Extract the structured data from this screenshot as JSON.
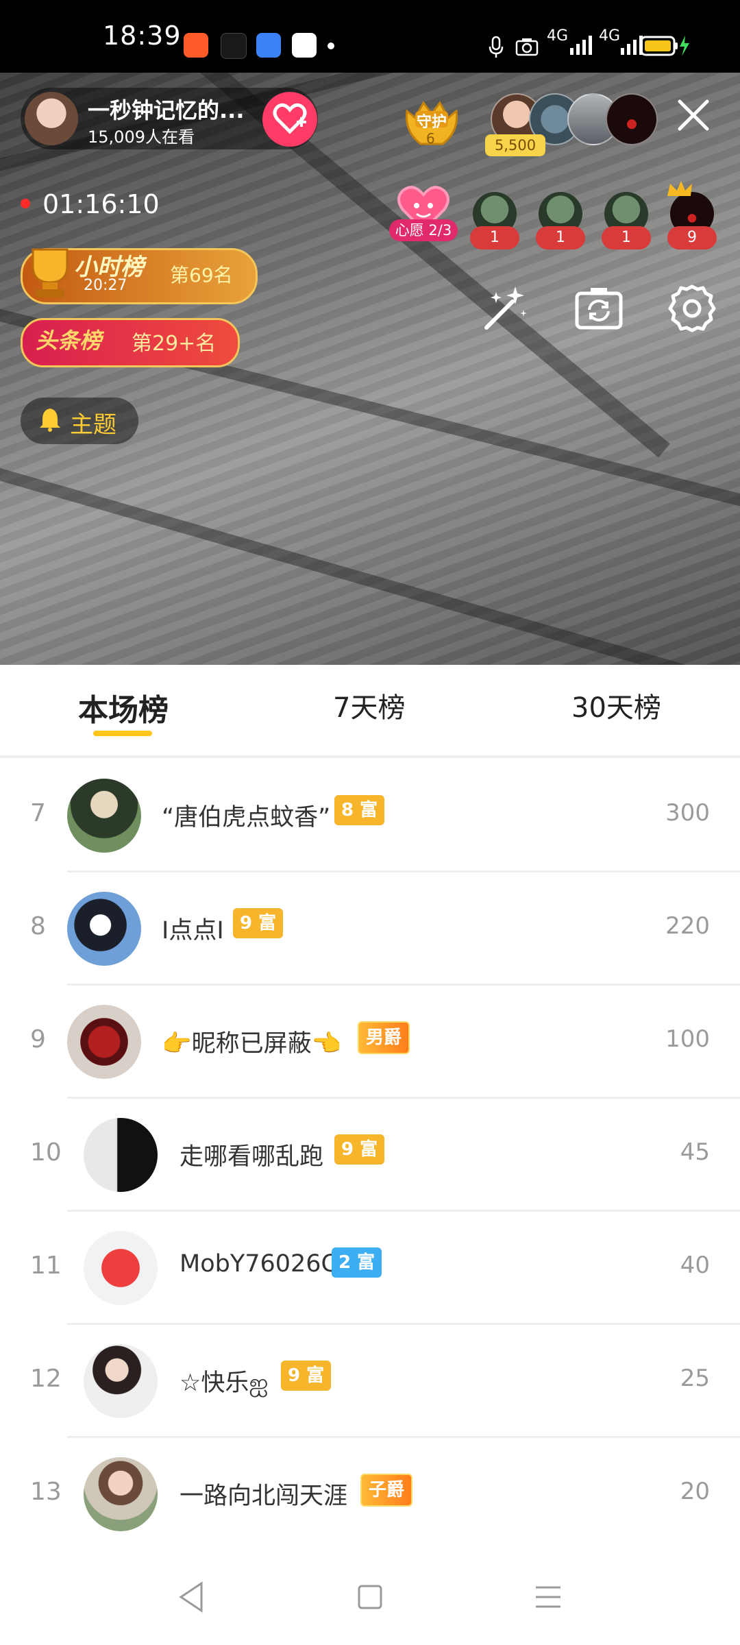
{
  "status_bar": {
    "time": "18:39",
    "net1": "4G",
    "net2": "4G",
    "icons": [
      "kuaishou-icon",
      "tiktok-icon",
      "cloud-icon",
      "browser-icon",
      "mic-icon",
      "camera-icon",
      "signal-icon",
      "signal-icon",
      "battery-icon"
    ]
  },
  "live": {
    "host_name": "一秒钟记忆的...",
    "viewers": "15,009人在看",
    "guard_label": "守护",
    "guard_count": "6",
    "top_score": "5,500",
    "record_time": "01:16:10",
    "wish_label": "心愿 2/3",
    "rank_counts": [
      "1",
      "1",
      "1",
      "9"
    ],
    "hour_badge": {
      "title": "小时榜",
      "time": "20:27",
      "rank": "第69名"
    },
    "head_badge": {
      "title": "头条榜",
      "rank": "第29+名"
    },
    "theme_label": "主题"
  },
  "tabs": [
    {
      "label": "本场榜",
      "active": true
    },
    {
      "label": "7天榜",
      "active": false
    },
    {
      "label": "30天榜",
      "active": false
    }
  ],
  "ranking": [
    {
      "rank": "7",
      "name": "“唐伯虎点蚊香”",
      "badge": "8 富",
      "badge_type": "gold",
      "score": "300"
    },
    {
      "rank": "8",
      "name": "I点点I",
      "badge": "9 富",
      "badge_type": "gold",
      "score": "220"
    },
    {
      "rank": "9",
      "name": "👉昵称已屏蔽👈",
      "badge": "男爵",
      "badge_type": "title",
      "score": "100"
    },
    {
      "rank": "10",
      "name": "走哪看哪乱跑",
      "badge": "9 富",
      "badge_type": "gold",
      "score": "45"
    },
    {
      "rank": "11",
      "name": "MobY76026C",
      "badge": "2 富",
      "badge_type": "blue",
      "score": "40"
    },
    {
      "rank": "12",
      "name": "☆快乐ஐ",
      "badge": "9 富",
      "badge_type": "gold",
      "score": "25"
    },
    {
      "rank": "13",
      "name": "一路向北闯天涯",
      "badge": "子爵",
      "badge_type": "title",
      "score": "20"
    }
  ]
}
